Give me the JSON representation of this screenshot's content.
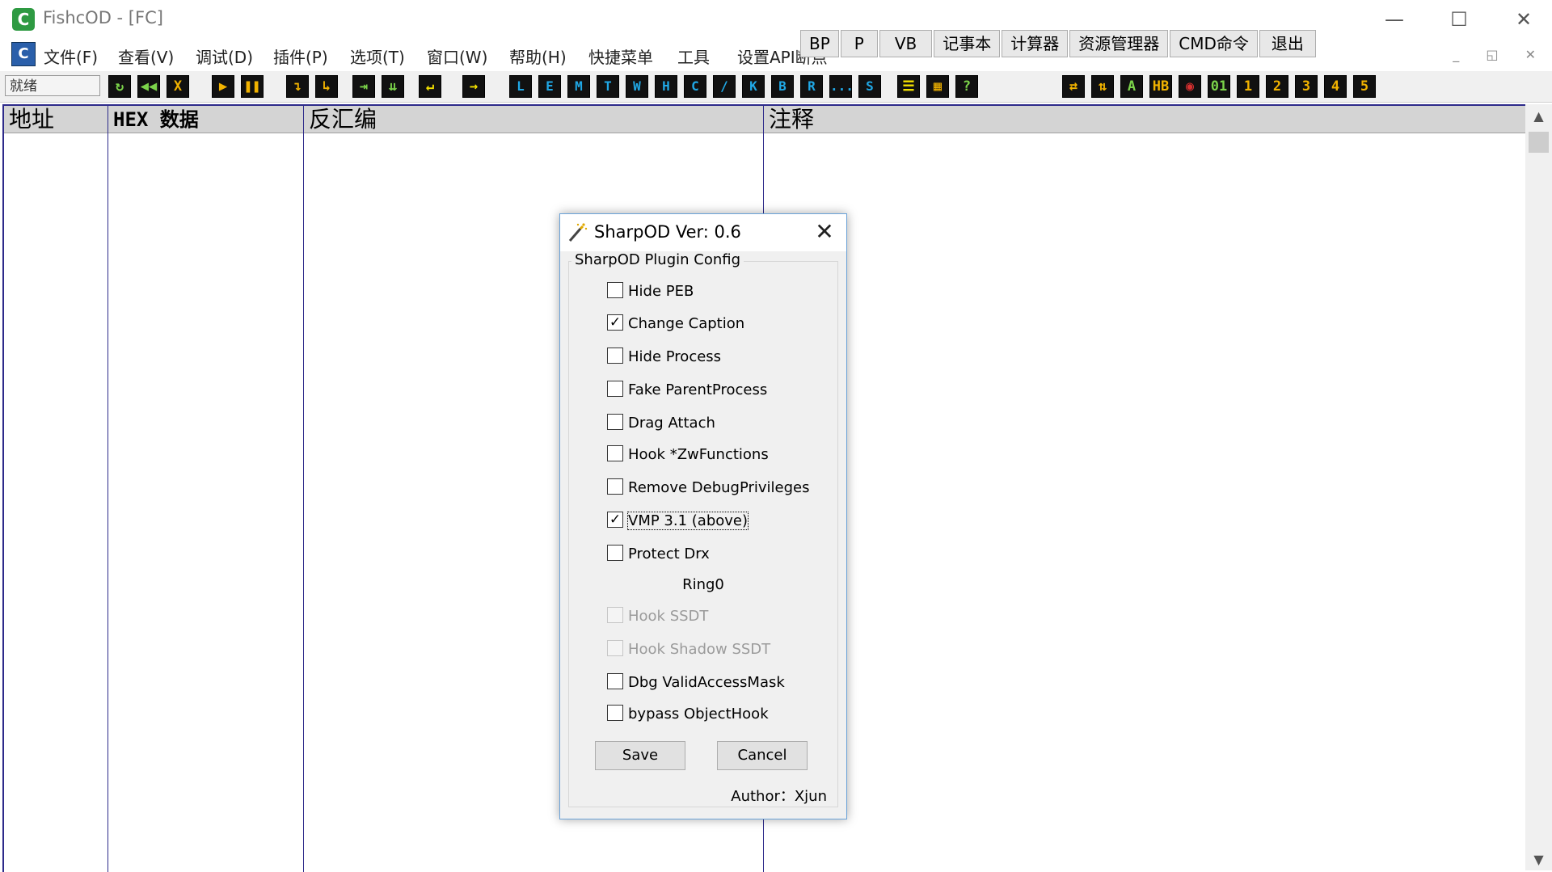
{
  "window": {
    "title": "FishcOD - [FC]",
    "app_icon_glyph": "C",
    "minimize": "—",
    "maximize": "☐",
    "close": "✕"
  },
  "menubar": {
    "icon_glyph": "C",
    "items": [
      "文件(F)",
      "查看(V)",
      "调试(D)",
      "插件(P)",
      "选项(T)",
      "窗口(W)",
      "帮助(H)",
      "快捷菜单",
      "工具",
      "设置API断点"
    ],
    "quick_buttons": [
      "BP",
      "P",
      "VB",
      "记事本",
      "计算器",
      "资源管理器",
      "CMD命令",
      "退出"
    ],
    "mdi_controls": "_ ◱ ✕"
  },
  "toolbar": {
    "status": "就绪",
    "buttons_group1": [
      "↻",
      "◀◀",
      "X",
      "▶",
      "❚❚",
      "↴",
      "↳",
      "⇥",
      "⇊",
      "↵",
      "→"
    ],
    "buttons_group2": [
      "L",
      "E",
      "M",
      "T",
      "W",
      "H",
      "C",
      "/",
      "K",
      "B",
      "R",
      "...",
      "S"
    ],
    "buttons_group3": [
      "☰",
      "▦",
      "?"
    ],
    "buttons_group4": [
      "⇄",
      "⇅",
      "A",
      "HB",
      "◉",
      "01",
      "1",
      "2",
      "3",
      "4",
      "5"
    ]
  },
  "columns": {
    "address": "地址",
    "hex": "HEX 数据",
    "disasm": "反汇编",
    "comment": "注释"
  },
  "scrollbar": {
    "up": "▲",
    "down": "▼"
  },
  "dialog": {
    "title": "SharpOD Ver: 0.6",
    "close": "✕",
    "group_label": "SharpOD Plugin Config",
    "options": [
      {
        "label": "Hide PEB",
        "checked": false
      },
      {
        "label": "Change Caption",
        "checked": true
      },
      {
        "label": "Hide Process",
        "checked": false
      },
      {
        "label": "Fake ParentProcess",
        "checked": false
      },
      {
        "label": "Drag Attach",
        "checked": false
      },
      {
        "label": "Hook *ZwFunctions",
        "checked": false
      },
      {
        "label": "Remove DebugPrivileges",
        "checked": false
      },
      {
        "label": "VMP 3.1 (above)",
        "checked": true
      },
      {
        "label": "Protect Drx",
        "checked": false
      }
    ],
    "ring0_label": "Ring0",
    "ring0_options": [
      {
        "label": "Hook SSDT",
        "checked": false,
        "disabled": true
      },
      {
        "label": "Hook Shadow SSDT",
        "checked": false,
        "disabled": true
      },
      {
        "label": "Dbg ValidAccessMask",
        "checked": false,
        "disabled": false
      },
      {
        "label": "bypass ObjectHook",
        "checked": false,
        "disabled": false
      }
    ],
    "save_label": "Save",
    "cancel_label": "Cancel",
    "author": "Author：Xjun",
    "check_mark": "✓"
  }
}
